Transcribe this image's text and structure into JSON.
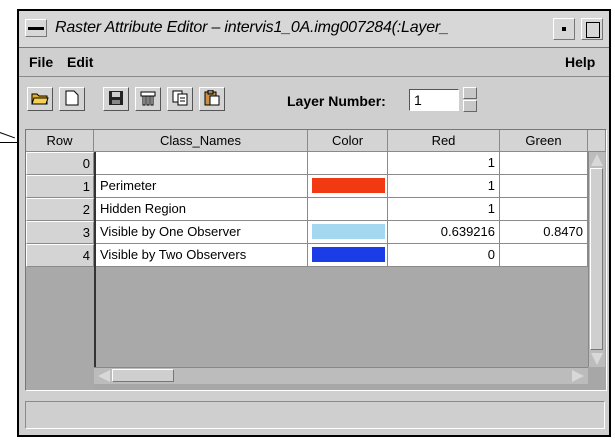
{
  "window": {
    "title": "Raster Attribute Editor – intervis1_0A.img007284(:Layer_"
  },
  "menubar": {
    "file": "File",
    "edit": "Edit",
    "help": "Help"
  },
  "toolbar": {
    "icons": [
      "open-folder-icon",
      "new-document-icon",
      "save-disk-icon",
      "column-properties-icon",
      "copy-icon",
      "paste-icon"
    ],
    "layer_number_label": "Layer Number:",
    "layer_number_value": "1"
  },
  "table": {
    "columns": [
      "Row",
      "Class_Names",
      "Color",
      "Red",
      "Green"
    ],
    "rows": [
      {
        "row": "0",
        "class_name": "",
        "color": "#ffffff",
        "red": "1",
        "green": ""
      },
      {
        "row": "1",
        "class_name": "Perimeter",
        "color": "#f23a12",
        "red": "1",
        "green": ""
      },
      {
        "row": "2",
        "class_name": "Hidden Region",
        "color": "#ffffff",
        "red": "1",
        "green": ""
      },
      {
        "row": "3",
        "class_name": "Visible by One Observer",
        "color": "#a3d8f0",
        "red": "0.639216",
        "green": "0.8470"
      },
      {
        "row": "4",
        "class_name": "Visible by Two Observers",
        "color": "#1a3de8",
        "red": "0",
        "green": ""
      }
    ]
  },
  "status": {
    "text": ""
  }
}
